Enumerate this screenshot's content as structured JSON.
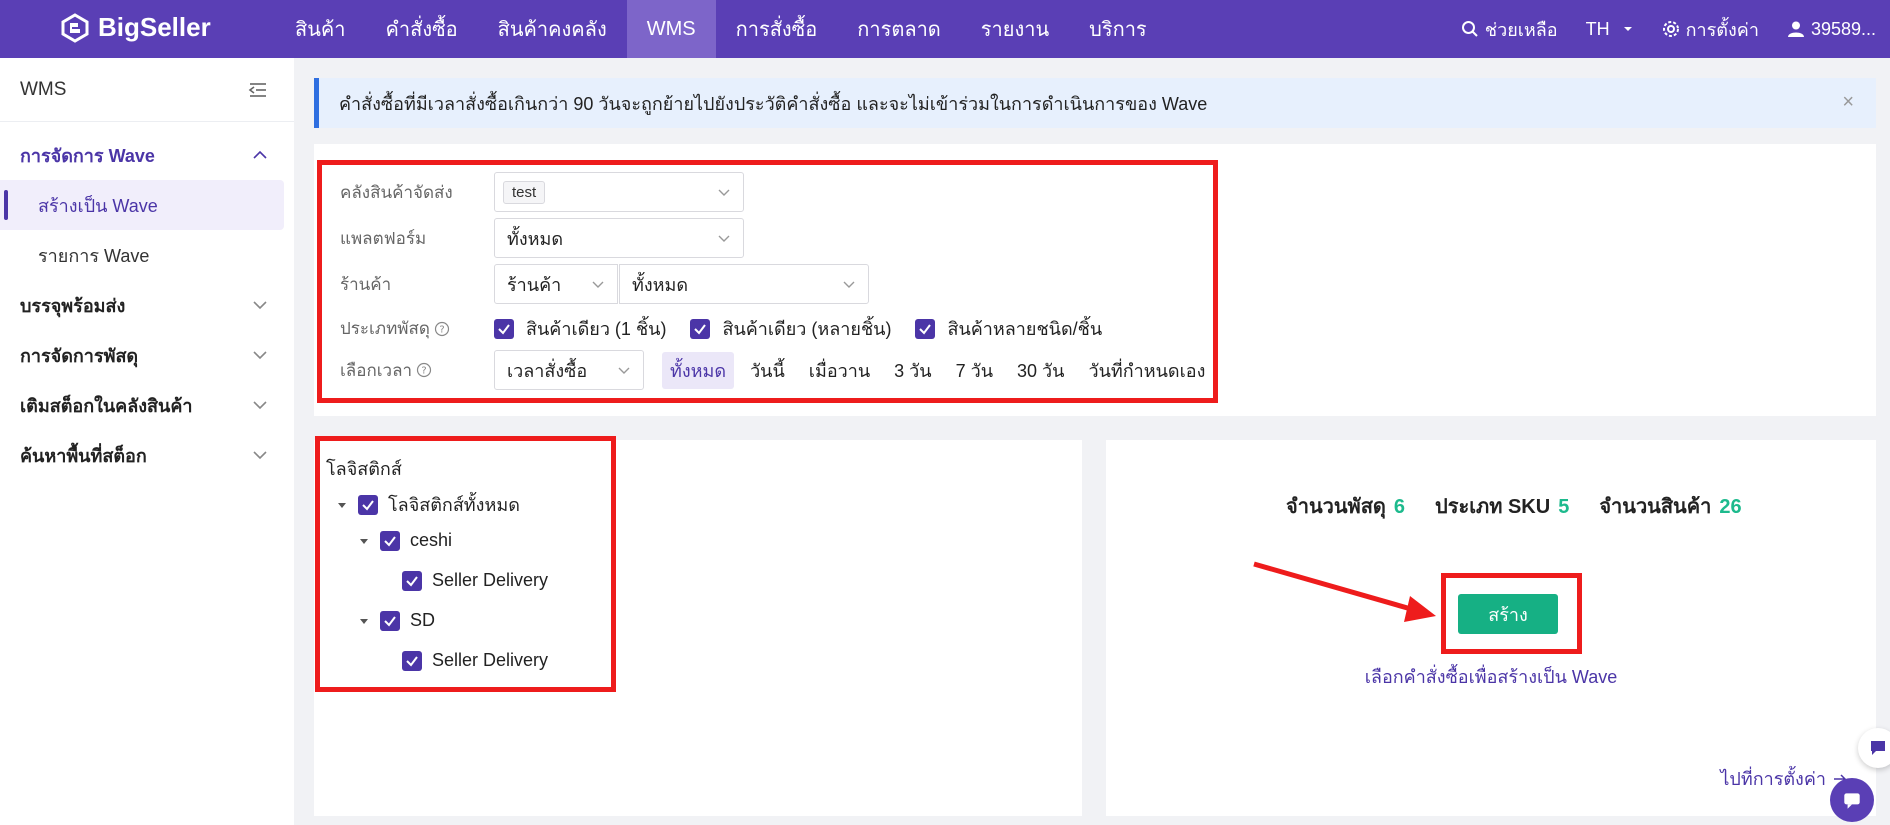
{
  "app": {
    "brand": "BigSeller"
  },
  "topnav": {
    "items": [
      {
        "label": "สินค้า"
      },
      {
        "label": "คำสั่งซื้อ"
      },
      {
        "label": "สินค้าคงคลัง"
      },
      {
        "label": "WMS"
      },
      {
        "label": "การสั่งซื้อ"
      },
      {
        "label": "การตลาด"
      },
      {
        "label": "รายงาน"
      },
      {
        "label": "บริการ"
      }
    ],
    "help": "ช่วยเหลือ",
    "lang": "TH",
    "settings": "การตั้งค่า",
    "user": "39589..."
  },
  "sidebar": {
    "title": "WMS",
    "group_wave": "การจัดการ Wave",
    "sub_create": "สร้างเป็น Wave",
    "sub_list": "รายการ Wave",
    "group_pack": "บรรจุพร้อมส่ง",
    "group_parcel": "การจัดการพัสดุ",
    "group_restock": "เติมสต็อกในคลังสินค้า",
    "group_search": "ค้นหาพื้นที่สต็อก"
  },
  "alert": {
    "text": "คำสั่งซื้อที่มีเวลาสั่งซื้อเกินกว่า 90 วันจะถูกย้ายไปยังประวัติคำสั่งซื้อ และจะไม่เข้าร่วมในการดำเนินการของ Wave",
    "close": "×"
  },
  "filters": {
    "warehouse_label": "คลังสินค้าจัดส่ง",
    "warehouse_tag": "test",
    "platform_label": "แพลตฟอร์ม",
    "platform_value": "ทั้งหมด",
    "store_label": "ร้านค้า",
    "store_type": "ร้านค้า",
    "store_value": "ทั้งหมด",
    "parcel_type_label": "ประเภทพัสดุ",
    "parcel_types": [
      "สินค้าเดียว (1 ชิ้น)",
      "สินค้าเดียว (หลายชิ้น)",
      "สินค้าหลายชนิด/ชิ้น"
    ],
    "time_label": "เลือกเวลา",
    "time_type": "เวลาสั่งซื้อ",
    "time_options": [
      "ทั้งหมด",
      "วันนี้",
      "เมื่อวาน",
      "3 วัน",
      "7 วัน",
      "30 วัน",
      "วันที่กำหนดเอง"
    ]
  },
  "logistics": {
    "title": "โลจิสติกส์",
    "all": "โลจิสติกส์ทั้งหมด",
    "groups": [
      {
        "name": "ceshi",
        "child": "Seller Delivery"
      },
      {
        "name": "SD",
        "child": "Seller Delivery"
      }
    ]
  },
  "summary": {
    "parcels_label": "จำนวนพัสดุ",
    "parcels": "6",
    "sku_label": "ประเภท SKU",
    "sku": "5",
    "items_label": "จำนวนสินค้า",
    "items": "26",
    "create_button": "สร้าง",
    "hint": "เลือกคำสั่งซื้อเพื่อสร้างเป็น Wave",
    "goto_settings": "ไปที่การตั้งค่า"
  },
  "colors": {
    "brand": "#5a3fb5",
    "accent": "#4b35a7",
    "success": "#16b084",
    "annotation": "#ee1c1c"
  }
}
